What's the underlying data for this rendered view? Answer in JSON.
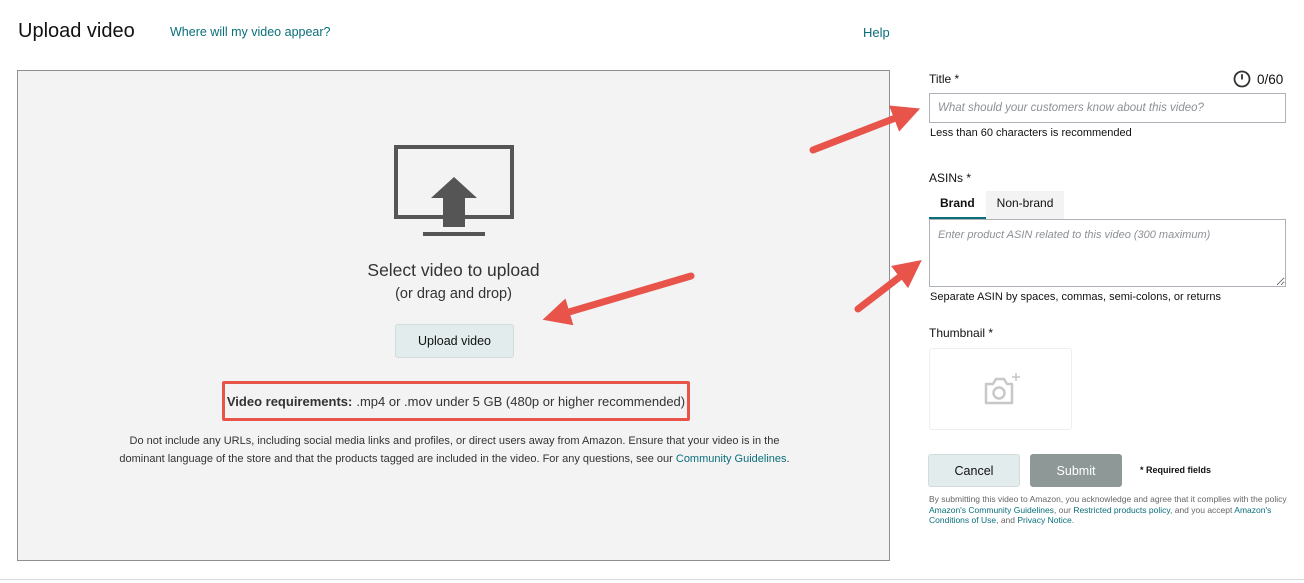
{
  "header": {
    "title": "Upload video",
    "where_link": "Where will my video appear?",
    "help_link": "Help"
  },
  "dropzone": {
    "icon": "monitor-upload-icon",
    "select_title": "Select video to upload",
    "select_subtitle": "(or drag and drop)",
    "upload_button": "Upload video",
    "requirements_label": "Video requirements:",
    "requirements_text": ".mp4 or .mov under 5 GB (480p or higher recommended)",
    "note_text": "Do not include any URLs, including social media links and profiles, or direct users away from Amazon. Ensure that your video is in the dominant language of the store and that the products tagged are included in the video. For any questions, see our ",
    "note_link": "Community Guidelines",
    "note_end": "."
  },
  "form": {
    "title_label": "Title *",
    "title_counter": "0/60",
    "title_value": "",
    "title_placeholder": "What should your customers know about this video?",
    "title_hint": "Less than 60 characters is recommended",
    "asins_label": "ASINs *",
    "tabs": [
      {
        "label": "Brand",
        "active": true
      },
      {
        "label": "Non-brand",
        "active": false
      }
    ],
    "asin_value": "",
    "asin_placeholder": "Enter product ASIN related to this video (300 maximum)",
    "asin_hint": "Separate ASIN by spaces, commas, semi-colons, or returns",
    "thumbnail_label": "Thumbnail *",
    "thumbnail_icon": "camera-add-icon",
    "cancel_button": "Cancel",
    "submit_button": "Submit",
    "required_note": "* Required fields"
  },
  "policy": {
    "text1": "By submitting this video to Amazon, you acknowledge and agree that it complies with the policy ",
    "link1": "Amazon's Community Guidelines",
    "text2": ", our ",
    "link2": "Restricted products policy",
    "text3": ", and you accept ",
    "link3": "Amazon's Conditions of Use",
    "text4": ", and ",
    "link4": "Privacy Notice",
    "text5": "."
  },
  "colors": {
    "accent": "#0a6f7b",
    "annotation": "#e8534a",
    "submit_disabled": "#8d9897",
    "secondary_button": "#e3ecec",
    "dropzone_bg": "#f3f3f3"
  }
}
